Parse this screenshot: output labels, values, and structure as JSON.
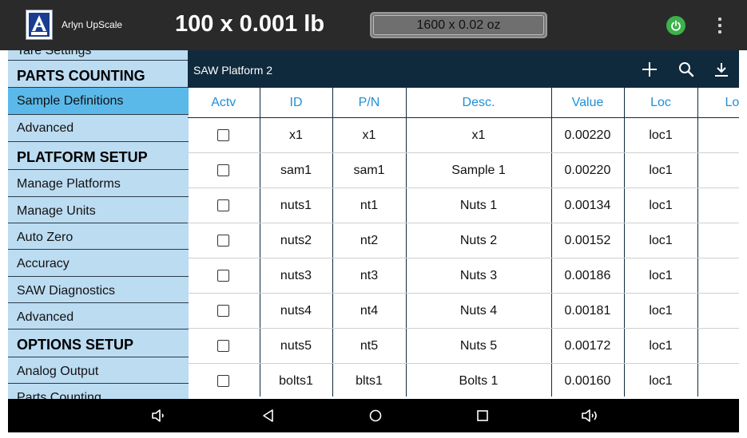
{
  "app": {
    "title": "Arlyn UpScale",
    "logo_text": "ARLYN"
  },
  "weights": {
    "primary": "100 x 0.001 lb",
    "secondary": "1600 x 0.02 oz"
  },
  "icons": {
    "power": "power-icon",
    "overflow": "more-vert-icon",
    "add": "add-icon",
    "search": "search-icon",
    "download": "download-icon",
    "nav": [
      "volume-down-icon",
      "back-icon",
      "home-icon",
      "recents-icon",
      "volume-up-icon"
    ]
  },
  "colors": {
    "accent_green": "#3bb24a",
    "selected": "#5bb9ea",
    "sidebar_bg": "#bcdcf2",
    "header_bg": "#0f2a3d",
    "column_header": "#1f8fd6"
  },
  "sidebar": {
    "items": [
      {
        "label": "Tare Settings",
        "type": "item"
      },
      {
        "label": "PARTS COUNTING",
        "type": "header"
      },
      {
        "label": "Sample Definitions",
        "type": "item",
        "selected": true
      },
      {
        "label": "Advanced",
        "type": "item"
      },
      {
        "label": "PLATFORM SETUP",
        "type": "header"
      },
      {
        "label": "Manage Platforms",
        "type": "item"
      },
      {
        "label": "Manage Units",
        "type": "item"
      },
      {
        "label": "Auto Zero",
        "type": "item"
      },
      {
        "label": "Accuracy",
        "type": "item"
      },
      {
        "label": "SAW Diagnostics",
        "type": "item"
      },
      {
        "label": "Advanced",
        "type": "item"
      },
      {
        "label": "OPTIONS SETUP",
        "type": "header"
      },
      {
        "label": "Analog Output",
        "type": "item"
      },
      {
        "label": "Parts Counting",
        "type": "item"
      }
    ]
  },
  "panel": {
    "title": "SAW Platform 2",
    "columns": [
      "Actv",
      "ID",
      "P/N",
      "Desc.",
      "Value",
      "Loc",
      "Lo"
    ],
    "rows": [
      {
        "active": false,
        "id": "x1",
        "pn": "x1",
        "desc": "x1",
        "value": "0.00220",
        "loc": "loc1"
      },
      {
        "active": false,
        "id": "sam1",
        "pn": "sam1",
        "desc": "Sample 1",
        "value": "0.00220",
        "loc": "loc1"
      },
      {
        "active": false,
        "id": "nuts1",
        "pn": "nt1",
        "desc": "Nuts 1",
        "value": "0.00134",
        "loc": "loc1"
      },
      {
        "active": false,
        "id": "nuts2",
        "pn": "nt2",
        "desc": "Nuts 2",
        "value": "0.00152",
        "loc": "loc1"
      },
      {
        "active": false,
        "id": "nuts3",
        "pn": "nt3",
        "desc": "Nuts 3",
        "value": "0.00186",
        "loc": "loc1"
      },
      {
        "active": false,
        "id": "nuts4",
        "pn": "nt4",
        "desc": "Nuts 4",
        "value": "0.00181",
        "loc": "loc1"
      },
      {
        "active": false,
        "id": "nuts5",
        "pn": "nt5",
        "desc": "Nuts 5",
        "value": "0.00172",
        "loc": "loc1"
      },
      {
        "active": false,
        "id": "bolts1",
        "pn": "blts1",
        "desc": "Bolts 1",
        "value": "0.00160",
        "loc": "loc1"
      }
    ]
  }
}
